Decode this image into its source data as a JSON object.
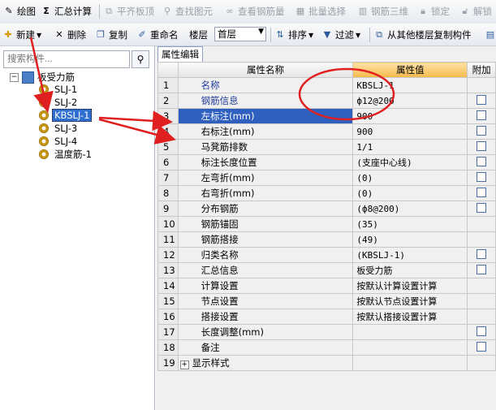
{
  "toolbar1": {
    "draw": "绘图",
    "sum_icon": "Σ",
    "calc": "汇总计算",
    "flat_top": "平齐板顶",
    "find_element": "查找图元",
    "view_rebar": "查看钢筋量",
    "batch_select": "批量选择",
    "rebar_3d": "钢筋三维",
    "lock": "锁定",
    "unlock": "解锁"
  },
  "toolbar2": {
    "new": "新建",
    "delete": "删除",
    "copy": "复制",
    "rename": "重命名",
    "floor_label": "楼层",
    "floor_value": "首层",
    "sort": "排序",
    "filter": "过滤",
    "copy_from_other": "从其他楼层复制构件"
  },
  "left": {
    "search_placeholder": "搜索构件...",
    "root": "板受力筋",
    "items": [
      "SLJ-1",
      "SLJ-2",
      "KBSLJ-1",
      "SLJ-3",
      "SLJ-4",
      "温度筋-1"
    ],
    "selected_index": 2
  },
  "right": {
    "tab": "属性编辑",
    "headers": {
      "name": "属性名称",
      "value": "属性值",
      "add": "附加"
    },
    "rows": [
      {
        "n": "1",
        "name": "名称",
        "value": "KBSLJ-1",
        "chk": false,
        "blue": true
      },
      {
        "n": "2",
        "name": "钢筋信息",
        "value": "ф12@200",
        "chk": true,
        "blue": true
      },
      {
        "n": "3",
        "name": "左标注(mm)",
        "value": "900",
        "chk": true,
        "blue": false
      },
      {
        "n": "4",
        "name": "右标注(mm)",
        "value": "900",
        "chk": true,
        "blue": false
      },
      {
        "n": "5",
        "name": "马凳筋排数",
        "value": "1/1",
        "chk": true,
        "blue": false
      },
      {
        "n": "6",
        "name": "标注长度位置",
        "value": "(支座中心线)",
        "chk": true,
        "blue": false
      },
      {
        "n": "7",
        "name": "左弯折(mm)",
        "value": "(0)",
        "chk": true,
        "blue": false
      },
      {
        "n": "8",
        "name": "右弯折(mm)",
        "value": "(0)",
        "chk": true,
        "blue": false
      },
      {
        "n": "9",
        "name": "分布钢筋",
        "value": "(ф8@200)",
        "chk": true,
        "blue": false
      },
      {
        "n": "10",
        "name": "钢筋锚固",
        "value": "(35)",
        "chk": false,
        "blue": false
      },
      {
        "n": "11",
        "name": "钢筋搭接",
        "value": "(49)",
        "chk": false,
        "blue": false
      },
      {
        "n": "12",
        "name": "归类名称",
        "value": "(KBSLJ-1)",
        "chk": true,
        "blue": false
      },
      {
        "n": "13",
        "name": "汇总信息",
        "value": "板受力筋",
        "chk": true,
        "blue": false
      },
      {
        "n": "14",
        "name": "计算设置",
        "value": "按默认计算设置计算",
        "chk": false,
        "blue": false
      },
      {
        "n": "15",
        "name": "节点设置",
        "value": "按默认节点设置计算",
        "chk": false,
        "blue": false
      },
      {
        "n": "16",
        "name": "搭接设置",
        "value": "按默认搭接设置计算",
        "chk": false,
        "blue": false
      },
      {
        "n": "17",
        "name": "长度调整(mm)",
        "value": "",
        "chk": true,
        "blue": false
      },
      {
        "n": "18",
        "name": "备注",
        "value": "",
        "chk": true,
        "blue": false
      },
      {
        "n": "19",
        "name": "显示样式",
        "value": "",
        "chk": false,
        "blue": false,
        "expand": "+"
      }
    ],
    "selected_row": 2
  },
  "colors": {
    "annotation_red": "#e02020",
    "selection_blue": "#2f5fbf"
  }
}
